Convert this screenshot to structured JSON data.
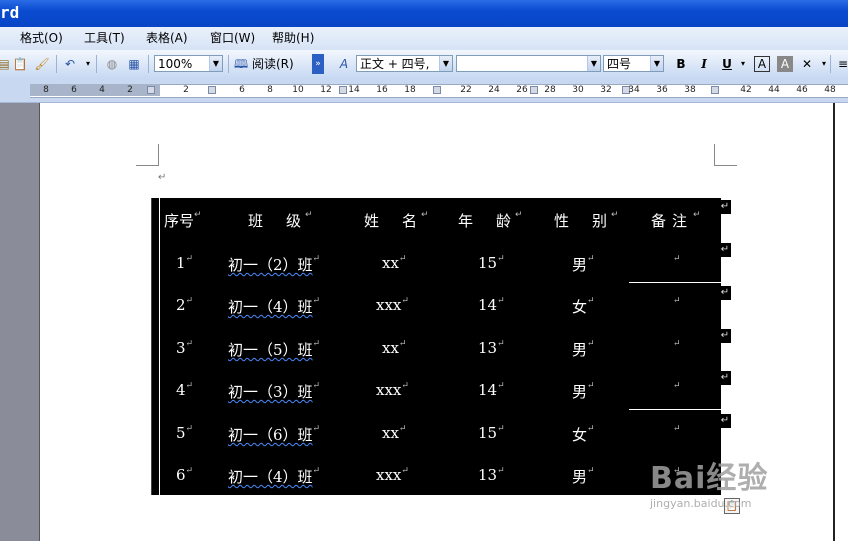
{
  "window": {
    "title": "rd"
  },
  "menu": [
    "格式(O)",
    "工具(T)",
    "表格(A)",
    "窗口(W)",
    "帮助(H)"
  ],
  "toolbar": {
    "zoom": "100%",
    "read_label": "阅读(R)",
    "style": "正文 + 四号,",
    "font_name": "",
    "font_size": "四号",
    "bold": "B",
    "italic": "I",
    "underline": "U"
  },
  "ruler": [
    "8",
    "6",
    "4",
    "2",
    "2",
    "6",
    "8",
    "10",
    "12",
    "14",
    "16",
    "18",
    "22",
    "24",
    "26",
    "28",
    "30",
    "32",
    "34",
    "36",
    "38",
    "42",
    "44",
    "46",
    "48"
  ],
  "document": {
    "paragraph_mark": "↵",
    "table": {
      "headers": [
        "序号",
        "班　级",
        "姓　名",
        "年　龄",
        "性　别",
        "备注"
      ],
      "rows": [
        [
          "1",
          "初一（2）班",
          "xx",
          "15",
          "男",
          ""
        ],
        [
          "2",
          "初一（4）班",
          "xxx",
          "14",
          "女",
          ""
        ],
        [
          "3",
          "初一（5）班",
          "xx",
          "13",
          "男",
          ""
        ],
        [
          "4",
          "初一（3）班",
          "xxx",
          "14",
          "男",
          ""
        ],
        [
          "5",
          "初一（6）班",
          "xx",
          "15",
          "女",
          ""
        ],
        [
          "6",
          "初一（4）班",
          "xxx",
          "13",
          "男",
          ""
        ]
      ]
    }
  },
  "watermark": {
    "brand": "Bai经验",
    "url": "jingyan.baidu.com"
  }
}
